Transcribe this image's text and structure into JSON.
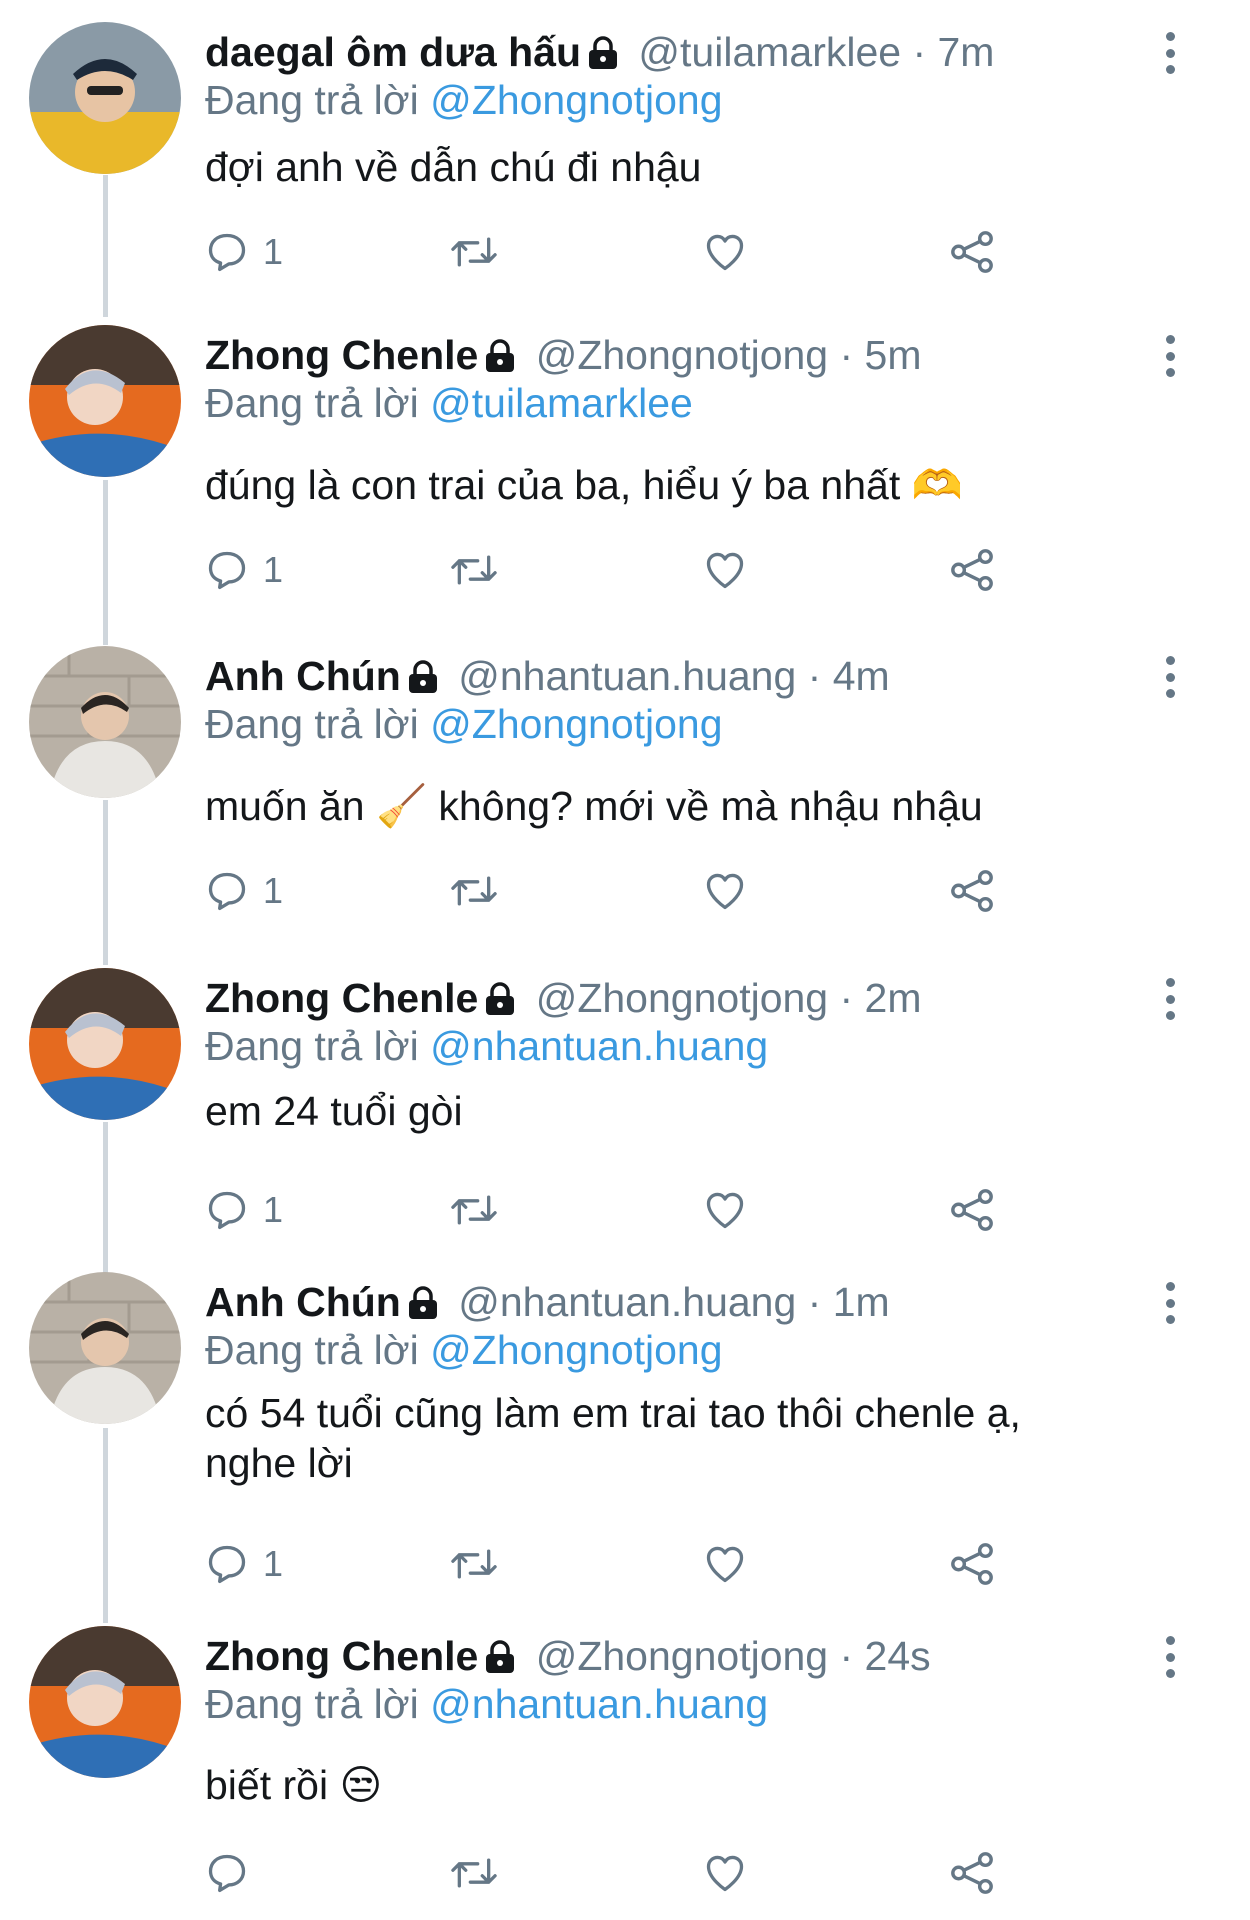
{
  "reply_prefix": "Đang trả lời",
  "tweets": [
    {
      "name": "daegal ôm dưa hấu",
      "handle": "@tuilamarklee",
      "time": "7m",
      "reply_to": "@Zhongnotjong",
      "text": "đợi anh về dẫn chú đi nhậu",
      "reply_count": "1"
    },
    {
      "name": "Zhong Chenle",
      "handle": "@Zhongnotjong",
      "time": "5m",
      "reply_to": "@tuilamarklee",
      "text": "đúng là con trai của ba, hiểu ý ba nhất 🫶",
      "reply_count": "1"
    },
    {
      "name": "Anh Chún",
      "handle": "@nhantuan.huang",
      "time": "4m",
      "reply_to": "@Zhongnotjong",
      "text": "muốn ăn 🧹 không? mới về mà nhậu nhậu",
      "reply_count": "1"
    },
    {
      "name": "Zhong Chenle",
      "handle": "@Zhongnotjong",
      "time": "2m",
      "reply_to": "@nhantuan.huang",
      "text": "em 24 tuổi gòi",
      "reply_count": "1"
    },
    {
      "name": "Anh Chún",
      "handle": "@nhantuan.huang",
      "time": "1m",
      "reply_to": "@Zhongnotjong",
      "text": "có 54 tuổi cũng làm em trai tao thôi chenle ạ, nghe lời",
      "reply_count": "1"
    },
    {
      "name": "Zhong Chenle",
      "handle": "@Zhongnotjong",
      "time": "24s",
      "reply_to": "@nhantuan.huang",
      "text": "biết rồi 😒",
      "reply_count": ""
    }
  ],
  "icons": {
    "reply": "reply-icon",
    "retweet": "retweet-icon",
    "like": "heart-icon",
    "share": "share-icon",
    "more": "more-vertical-icon",
    "lock": "lock-icon"
  },
  "colors": {
    "link": "#3a9ae0",
    "secondary": "#657786",
    "text": "#14171a",
    "thread_line": "#cfd6dc"
  }
}
